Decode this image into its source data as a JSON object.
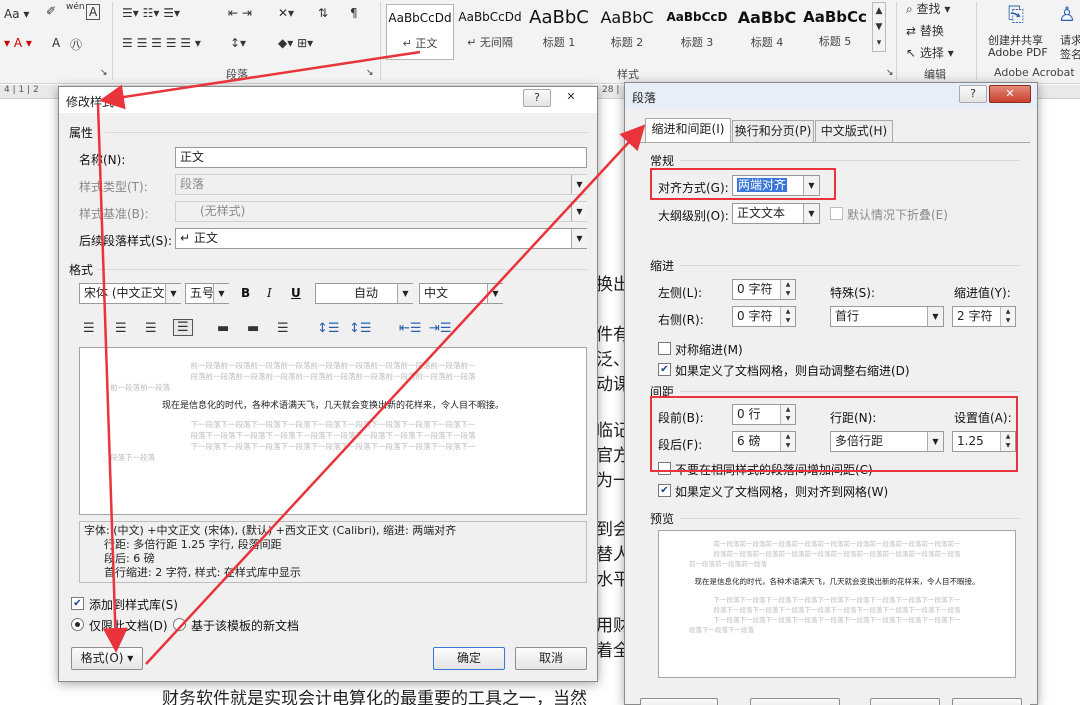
{
  "ribbon": {
    "font_row": {
      "aa": "Aa",
      "pinyin": "wén",
      "char_box": "A"
    },
    "styles": [
      {
        "sample": "AaBbCcDd",
        "name": "↵ 正文"
      },
      {
        "sample": "AaBbCcDd",
        "name": "↵ 无间隔"
      },
      {
        "sample": "AaBbC",
        "name": "标题 1"
      },
      {
        "sample": "AaBbC",
        "name": "标题 2"
      },
      {
        "sample": "AaBbCcD",
        "name": "标题 3"
      },
      {
        "sample": "AaBbC",
        "name": "标题 4"
      },
      {
        "sample": "AaBbCc",
        "name": "标题 5"
      }
    ],
    "groups": {
      "paragraph": "段落",
      "styles": "样式",
      "editing": "编辑",
      "acrobat": "Adobe Acrobat"
    },
    "editing": {
      "find": "查找",
      "replace": "替换",
      "select": "选择"
    },
    "acrobat": {
      "create_line1": "创建并共享",
      "create_line2": "Adobe PDF",
      "request_line1": "请求",
      "request_line2": "签名"
    }
  },
  "ruler": {
    "left": "4 | 1 | 2",
    "right": "28 |"
  },
  "document": {
    "fragments": [
      "换出",
      "件有",
      "泛、",
      "动课",
      "临记",
      "官方",
      "为一",
      "到会",
      "替人",
      "水平",
      "用财",
      "着全"
    ],
    "bottom_line": "财务软件就是实现会计电算化的最重要的工具之一，当然"
  },
  "modify_style": {
    "title": "修改样式",
    "help": "?",
    "close": "✕",
    "section_properties": "属性",
    "name_label": "名称(N):",
    "name_value": "正文",
    "type_label": "样式类型(T):",
    "type_value": "段落",
    "based_label": "样式基准(B):",
    "based_value": "(无样式)",
    "next_label": "后续段落样式(S):",
    "next_value": "↵ 正文",
    "section_format": "格式",
    "font": "宋体 (中文正文)",
    "size": "五号",
    "bold": "B",
    "italic": "I",
    "underline": "U",
    "color": "自动",
    "lang": "中文",
    "preview_prev": [
      "前一段落前一段落前一段落前一段落前一段落前一段落前一段落前一段落前一段落前一",
      "段落前一段落前一段落前一段落前一段落前一段落前一段落前一段落前一段落前一段落",
      "前一段落前一段落"
    ],
    "preview_main": "现在是信息化的时代，各种术语满天飞，几天就会变换出新的花样来，令人目不暇接。",
    "preview_next": [
      "下一段落下一段落下一段落下一段落下一段落下一段落下一段落下一段落下一段落下一",
      "段落下一段落下一段落下一段落下一段落下一段落下一段落下一段落下一段落下一段落",
      "下一段落下一段落下一段落下一段落下一段落下一段落下一段落下一段落下一段落下一",
      "段落下一段落"
    ],
    "desc_lines": [
      "字体: (中文) +中文正文 (宋体), (默认) +西文正文 (Calibri), 缩进: 两端对齐",
      "行距: 多倍行距 1.25 字行, 段落间距",
      "段后: 6 磅",
      "首行缩进: 2 字符, 样式: 在样式库中显示"
    ],
    "add_gallery": "添加到样式库(S)",
    "only_doc": "仅限此文档(D)",
    "new_docs": "基于该模板的新文档",
    "format_btn": "格式(O) ▾",
    "ok": "确定",
    "cancel": "取消"
  },
  "paragraph": {
    "title": "段落",
    "help": "?",
    "close": "✕",
    "tabs": [
      "缩进和间距(I)",
      "换行和分页(P)",
      "中文版式(H)"
    ],
    "general": "常规",
    "align_label": "对齐方式(G):",
    "align_value": "两端对齐",
    "outline_label": "大纲级别(O):",
    "outline_value": "正文文本",
    "collapse": "默认情况下折叠(E)",
    "indent": "缩进",
    "left_label": "左侧(L):",
    "left_value": "0 字符",
    "right_label": "右侧(R):",
    "right_value": "0 字符",
    "special_label": "特殊(S):",
    "special_value": "首行",
    "indent_by_label": "缩进值(Y):",
    "indent_by_value": "2 字符",
    "mirror": "对称缩进(M)",
    "auto_right": "如果定义了文档网格，则自动调整右缩进(D)",
    "spacing": "间距",
    "before_label": "段前(B):",
    "before_value": "0 行",
    "after_label": "段后(F):",
    "after_value": "6 磅",
    "line_label": "行距(N):",
    "line_value": "多倍行距",
    "at_label": "设置值(A):",
    "at_value": "1.25",
    "no_space": "不要在相同样式的段落间增加间距(C)",
    "snap": "如果定义了文档网格，则对齐到网格(W)",
    "preview": "预览",
    "preview_prev": [
      "前一段落前一段落前一段落前一段落前一段落前一段落前一段落前一段落前一段落前一",
      "段落前一段落前一段落前一段落前一段落前一段落前一段落前一段落前一段落前一段落",
      "前一段落前一段落前一段落"
    ],
    "preview_main": "现在是信息化的时代，各种术语满天飞，几天就会变换出新的花样来，令人目不暇接。",
    "preview_next": [
      "下一段落下一段落下一段落下一段落下一段落下一段落下一段落下一段落下一段落下一",
      "段落下一段落下一段落下一段落下一段落下一段落下一段落下一段落下一段落下一段落",
      "下一段落下一段落下一段落下一段落下一段落下一段落下一段落下一段落下一段落下一",
      "段落下一段落下一段落"
    ]
  },
  "colors": {
    "annotation": "#e8343a",
    "accent": "#3a76d8"
  }
}
